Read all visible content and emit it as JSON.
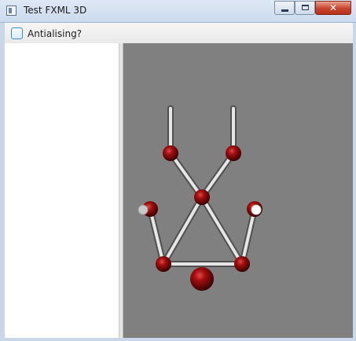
{
  "window": {
    "title": "Test FXML 3D",
    "icon": "app-window-icon",
    "controls": [
      "minimize",
      "maximize",
      "close"
    ]
  },
  "toolbar": {
    "antialiasing_label": "Antialising?",
    "antialiasing_checked": false
  },
  "scene": {
    "background": "#808080",
    "node_color": "#8b0000",
    "rod_color": "#d9d9d9",
    "highlight_color": "#ffffff"
  }
}
